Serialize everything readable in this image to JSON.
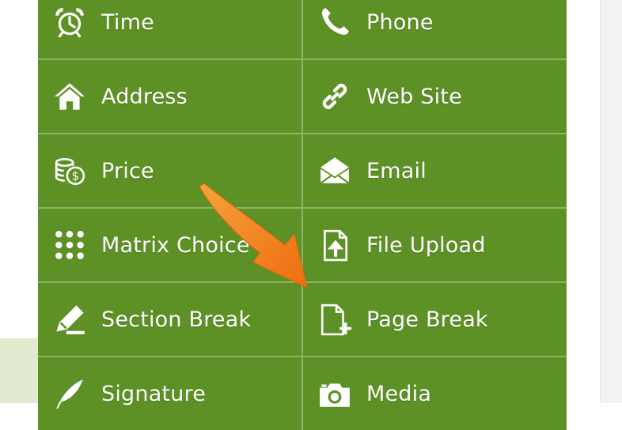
{
  "fields": [
    {
      "label": "Time",
      "icon": "alarm-clock-icon"
    },
    {
      "label": "Phone",
      "icon": "phone-icon"
    },
    {
      "label": "Address",
      "icon": "home-icon"
    },
    {
      "label": "Web Site",
      "icon": "link-icon"
    },
    {
      "label": "Price",
      "icon": "coins-icon"
    },
    {
      "label": "Email",
      "icon": "envelope-icon"
    },
    {
      "label": "Matrix Choice",
      "icon": "dot-grid-icon"
    },
    {
      "label": "File Upload",
      "icon": "file-upload-icon"
    },
    {
      "label": "Section Break",
      "icon": "pencil-icon"
    },
    {
      "label": "Page Break",
      "icon": "new-page-icon"
    },
    {
      "label": "Signature",
      "icon": "feather-icon"
    },
    {
      "label": "Media",
      "icon": "camera-icon"
    }
  ],
  "colors": {
    "tile": "#5e9125",
    "tile_border": "#8bb36a",
    "arrow": "#f07a1a",
    "text": "#ffffff"
  }
}
